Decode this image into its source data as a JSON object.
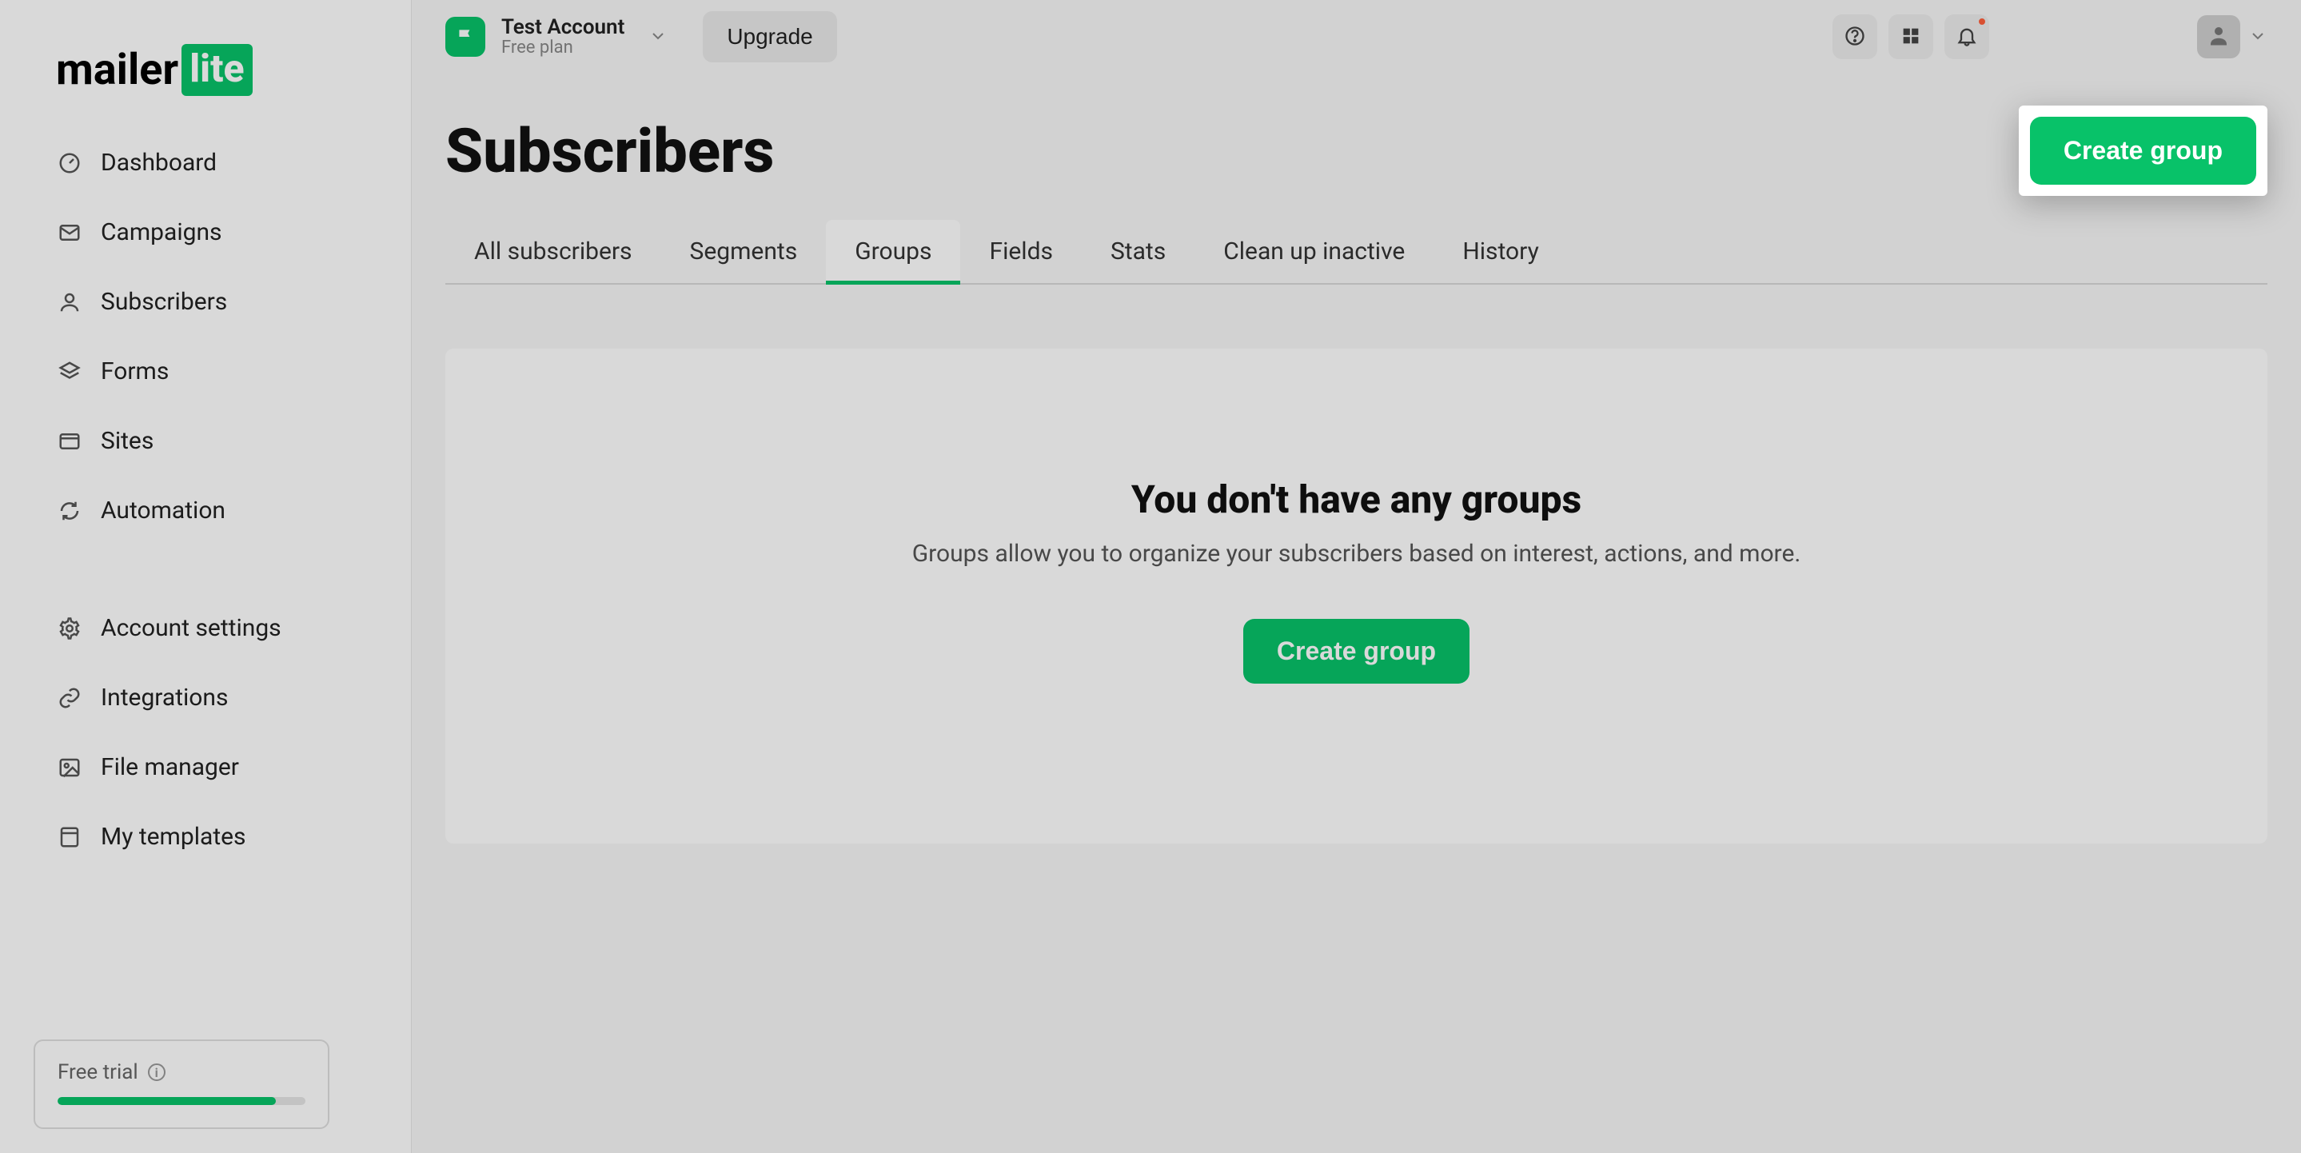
{
  "brand": {
    "name_part1": "mailer",
    "name_part2": "lite"
  },
  "account": {
    "name": "Test Account",
    "plan": "Free plan",
    "upgrade_label": "Upgrade"
  },
  "colors": {
    "accent": "#08c269"
  },
  "sidebar": {
    "items": [
      {
        "label": "Dashboard",
        "icon": "gauge-icon",
        "active": false
      },
      {
        "label": "Campaigns",
        "icon": "envelope-icon",
        "active": false
      },
      {
        "label": "Subscribers",
        "icon": "user-icon",
        "active": true
      },
      {
        "label": "Forms",
        "icon": "layers-icon",
        "active": false
      },
      {
        "label": "Sites",
        "icon": "browser-icon",
        "active": false
      },
      {
        "label": "Automation",
        "icon": "refresh-icon",
        "active": false
      },
      {
        "label": "Account settings",
        "icon": "gear-icon",
        "active": false
      },
      {
        "label": "Integrations",
        "icon": "link-icon",
        "active": false
      },
      {
        "label": "File manager",
        "icon": "image-icon",
        "active": false
      },
      {
        "label": "My templates",
        "icon": "template-icon",
        "active": false
      }
    ],
    "trial": {
      "label": "Free trial",
      "progress_pct": 88
    }
  },
  "page": {
    "title": "Subscribers",
    "create_group_label": "Create group"
  },
  "tabs": [
    {
      "label": "All subscribers",
      "active": false
    },
    {
      "label": "Segments",
      "active": false
    },
    {
      "label": "Groups",
      "active": true
    },
    {
      "label": "Fields",
      "active": false
    },
    {
      "label": "Stats",
      "active": false
    },
    {
      "label": "Clean up inactive",
      "active": false
    },
    {
      "label": "History",
      "active": false
    }
  ],
  "empty_state": {
    "title": "You don't have any groups",
    "subtitle": "Groups allow you to organize your subscribers based on interest, actions, and more.",
    "button_label": "Create group"
  }
}
